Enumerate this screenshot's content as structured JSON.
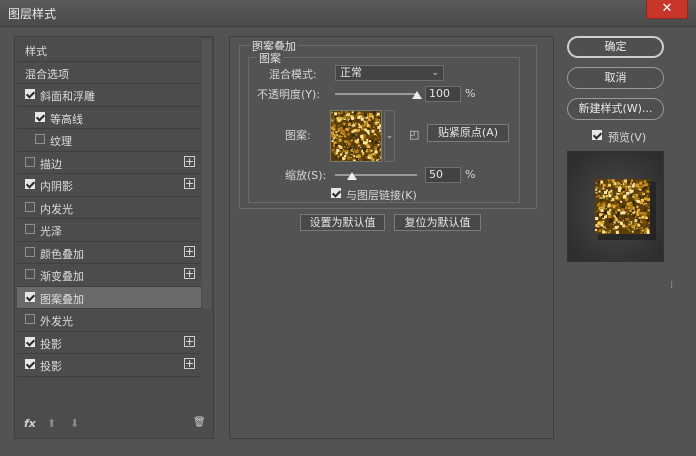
{
  "window": {
    "title": "图层样式",
    "close_glyph": "✕"
  },
  "left_panel": {
    "items": [
      {
        "label": "样式",
        "checkbox": null,
        "checked": false,
        "indent": 0,
        "plus": false,
        "selected": false
      },
      {
        "label": "混合选项",
        "checkbox": null,
        "checked": false,
        "indent": 0,
        "plus": false,
        "selected": false
      },
      {
        "label": "斜面和浮雕",
        "checkbox": true,
        "checked": true,
        "indent": 0,
        "plus": false,
        "selected": false
      },
      {
        "label": "等高线",
        "checkbox": true,
        "checked": true,
        "indent": 1,
        "plus": false,
        "selected": false
      },
      {
        "label": "纹理",
        "checkbox": true,
        "checked": false,
        "indent": 1,
        "plus": false,
        "selected": false
      },
      {
        "label": "描边",
        "checkbox": true,
        "checked": false,
        "indent": 0,
        "plus": true,
        "selected": false
      },
      {
        "label": "内阴影",
        "checkbox": true,
        "checked": true,
        "indent": 0,
        "plus": true,
        "selected": false
      },
      {
        "label": "内发光",
        "checkbox": true,
        "checked": false,
        "indent": 0,
        "plus": false,
        "selected": false
      },
      {
        "label": "光泽",
        "checkbox": true,
        "checked": false,
        "indent": 0,
        "plus": false,
        "selected": false
      },
      {
        "label": "颜色叠加",
        "checkbox": true,
        "checked": false,
        "indent": 0,
        "plus": true,
        "selected": false
      },
      {
        "label": "渐变叠加",
        "checkbox": true,
        "checked": false,
        "indent": 0,
        "plus": true,
        "selected": false
      },
      {
        "label": "图案叠加",
        "checkbox": true,
        "checked": true,
        "indent": 0,
        "plus": false,
        "selected": true
      },
      {
        "label": "外发光",
        "checkbox": true,
        "checked": false,
        "indent": 0,
        "plus": false,
        "selected": false
      },
      {
        "label": "投影",
        "checkbox": true,
        "checked": true,
        "indent": 0,
        "plus": true,
        "selected": false
      },
      {
        "label": "投影",
        "checkbox": true,
        "checked": true,
        "indent": 0,
        "plus": true,
        "selected": false
      }
    ],
    "bottom": {
      "fx": "fx",
      "up": "⬆",
      "down": "⬇",
      "trash": "🗑"
    }
  },
  "pattern_overlay": {
    "group_title": "图案叠加",
    "sub_title": "图案",
    "blend_mode_label": "混合模式:",
    "blend_mode_value": "正常",
    "opacity_label": "不透明度(Y):",
    "opacity_value": "100",
    "opacity_unit": "%",
    "opacity_fraction": 1.0,
    "pattern_label": "图案:",
    "snap_button": "贴紧原点(A)",
    "scale_label": "缩放(S):",
    "scale_value": "50",
    "scale_unit": "%",
    "scale_fraction": 0.21,
    "link_label": "与图层链接(K)",
    "link_checked": true,
    "set_default": "设置为默认值",
    "reset_default": "复位为默认值"
  },
  "right": {
    "ok": "确定",
    "cancel": "取消",
    "new_style": "新建样式(W)...",
    "preview_label": "预览(V)",
    "preview_checked": true
  },
  "colors": {
    "accent": "#e6e6e6",
    "gold": "#b8860b"
  }
}
